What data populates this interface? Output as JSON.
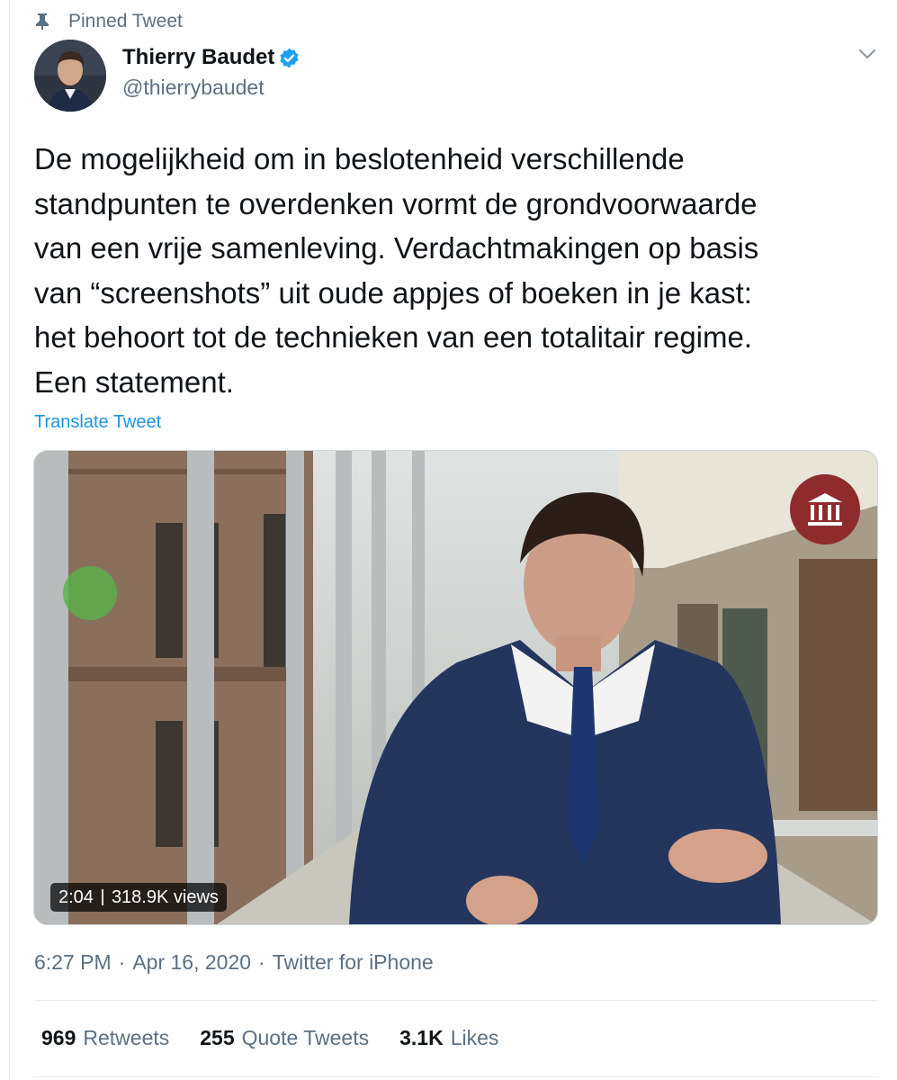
{
  "pinned": {
    "label": "Pinned Tweet",
    "icon": "pin-icon"
  },
  "author": {
    "name": "Thierry Baudet",
    "handle": "@thierrybaudet",
    "verified": true,
    "avatar_icon": "avatar-portrait"
  },
  "tweet": {
    "text": "De mogelijkheid om in beslotenheid verschillende\nstandpunten te overdenken vormt de grondvoorwaarde\nvan een vrije samenleving. Verdachtmakingen op basis\nvan “screenshots” uit oude appjes of boeken in je kast:\nhet behoort tot de technieken van een totalitair regime.\nEen statement.",
    "translate_label": "Translate Tweet"
  },
  "media": {
    "duration": "2:04",
    "views": "318.9K views",
    "badge_icon": "parliament-building-icon"
  },
  "meta": {
    "time": "6:27 PM",
    "date": "Apr 16, 2020",
    "source": "Twitter for iPhone",
    "separator": "·"
  },
  "stats": [
    {
      "count": "969",
      "label": "Retweets"
    },
    {
      "count": "255",
      "label": "Quote Tweets"
    },
    {
      "count": "3.1K",
      "label": "Likes"
    }
  ],
  "colors": {
    "accent": "#1b95e0",
    "verified": "#1da1f2",
    "muted": "#5b7083",
    "badge": "#8e2b2d"
  }
}
